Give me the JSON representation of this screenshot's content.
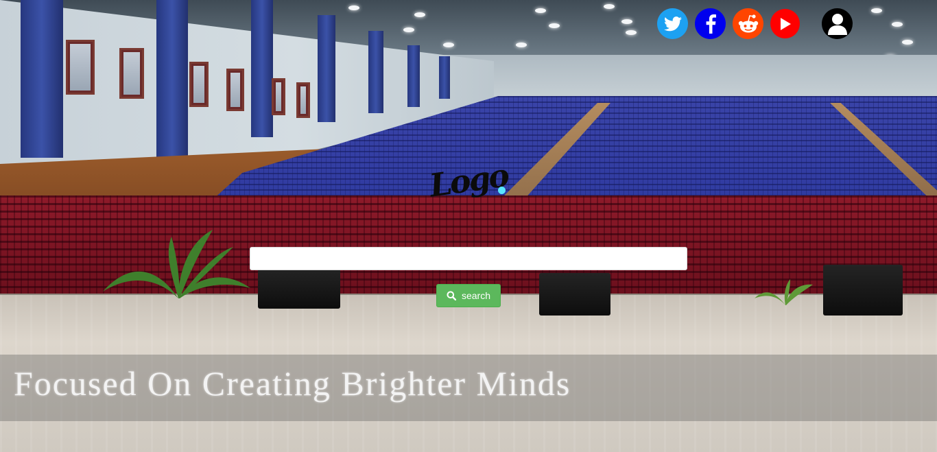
{
  "header": {
    "social": [
      {
        "name": "twitter-icon",
        "color": "#1da1f2"
      },
      {
        "name": "facebook-icon",
        "color": "#0000ee"
      },
      {
        "name": "reddit-icon",
        "color": "#ff4500"
      },
      {
        "name": "youtube-icon",
        "color": "#ff0000"
      }
    ],
    "user_icon": "user-icon"
  },
  "logo": {
    "text": "Logo"
  },
  "search": {
    "value": "",
    "placeholder": "",
    "button_label": "search",
    "button_color": "#5cb85c",
    "icon": "search-icon"
  },
  "hero": {
    "tagline": "Focused On Creating Brighter Minds"
  }
}
